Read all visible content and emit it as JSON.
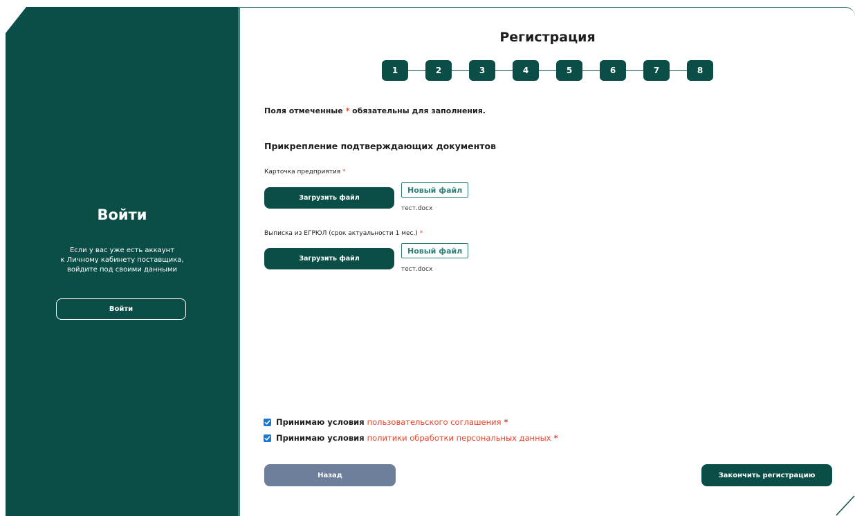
{
  "left": {
    "title": "Войти",
    "description_lines": [
      "Если у вас уже есть аккаунт",
      "к Личному кабинету поставщика,",
      "войдите под своими данными"
    ],
    "login_button": "Войти"
  },
  "header": {
    "title": "Регистрация",
    "steps": [
      "1",
      "2",
      "3",
      "4",
      "5",
      "6",
      "7",
      "8"
    ]
  },
  "form": {
    "required_note_before": "Поля отмеченные",
    "required_star": "*",
    "required_note_after": "обязательны для заполнения.",
    "section_title": "Прикрепление подтверждающих документов",
    "fields": [
      {
        "label": "Карточка предприятия",
        "upload_label": "Загрузить файл",
        "new_file_label": "Новый файл",
        "file_name": "тест.docx"
      },
      {
        "label": "Выписка из ЕГРЮЛ (срок актуальности 1 мес.)",
        "upload_label": "Загрузить файл",
        "new_file_label": "Новый файл",
        "file_name": "тест.docx"
      }
    ]
  },
  "agreements": [
    {
      "checked": true,
      "text": "Принимаю условия",
      "link": "пользовательского соглашения"
    },
    {
      "checked": true,
      "text": "Принимаю условия",
      "link": "политики обработки персональных данных"
    }
  ],
  "footer": {
    "back_label": "Назад",
    "finish_label": "Закончить регистрацию"
  },
  "colors": {
    "brand": "#0b4d47",
    "accent_red": "#e8442a",
    "checkbox_blue": "#1976d2",
    "back_button": "#6e7f9b",
    "new_file_tag": "#2e7f77"
  }
}
